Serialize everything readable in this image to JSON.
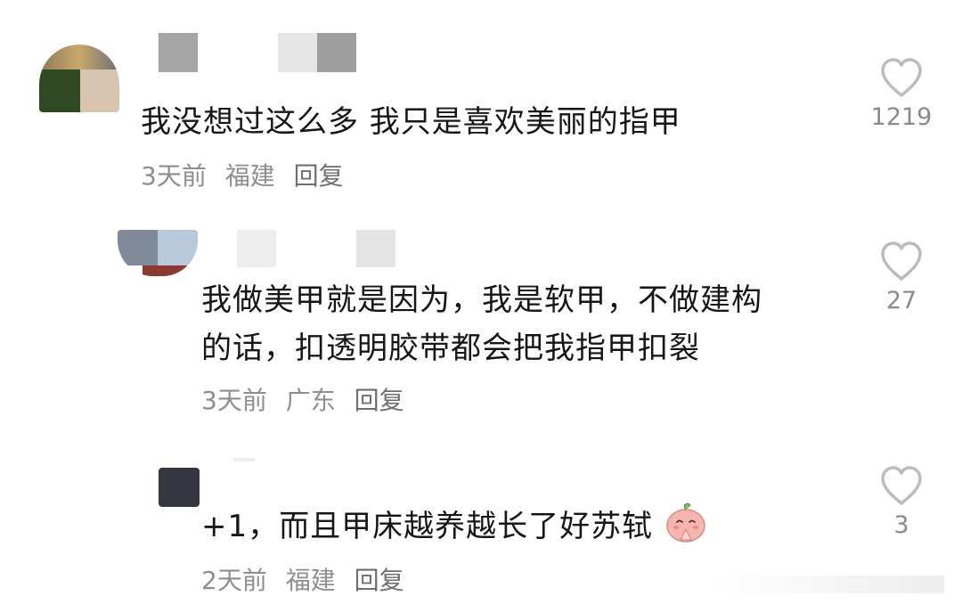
{
  "comments": [
    {
      "text": "我没想过这么多 我只是喜欢美丽的指甲",
      "time": "3天前",
      "location": "福建",
      "reply_label": "回复",
      "likes": "1219"
    },
    {
      "text_line1": "我做美甲就是因为，我是软甲，不做建构",
      "text_line2": "的话，扣透明胶带都会把我指甲扣裂",
      "time": "3天前",
      "location": "广东",
      "reply_label": "回复",
      "likes": "27"
    },
    {
      "text": "+1，而且甲床越养越长了好苏轼",
      "emoji": "praying-peach-emoji",
      "time": "2天前",
      "location": "福建",
      "reply_label": "回复",
      "likes": "3"
    }
  ],
  "colors": {
    "meta_text": "#8e8e8e",
    "like_icon": "#bcbcbc",
    "main_text": "#161616"
  }
}
